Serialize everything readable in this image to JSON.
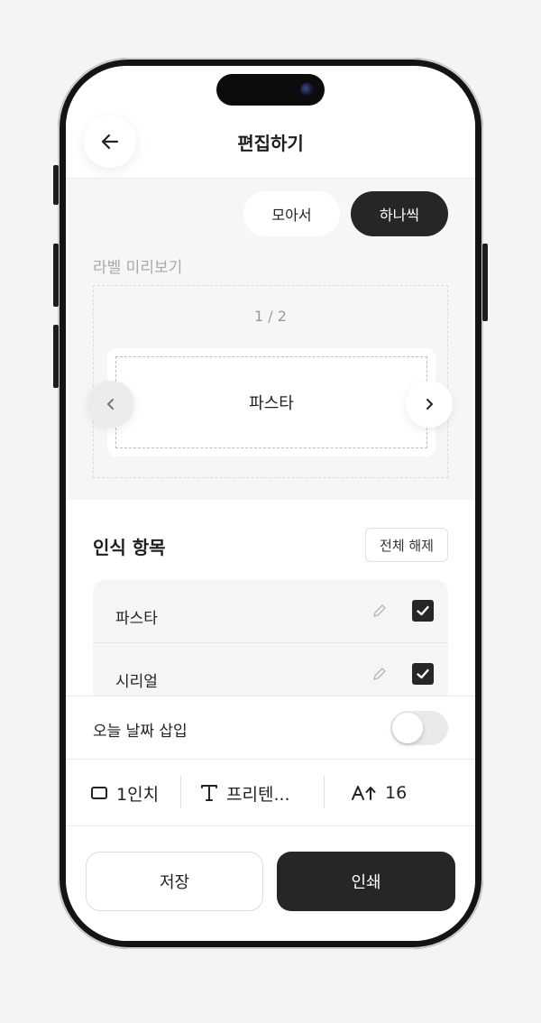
{
  "header": {
    "title": "편집하기",
    "back_icon": "arrow-left-icon"
  },
  "preview": {
    "mode_gather": "모아서",
    "mode_single": "하나씩",
    "active_mode": "하나씩",
    "section_label": "라벨 미리보기",
    "page_counter": "1 / 2",
    "label_text": "파스타"
  },
  "recognized": {
    "title": "인식 항목",
    "deselect_all": "전체 해제",
    "items": [
      {
        "label": "파스타",
        "checked": true
      },
      {
        "label": "시리얼",
        "checked": true
      }
    ]
  },
  "options": {
    "date_insert_label": "오늘 날짜 삽입",
    "date_insert_on": false,
    "label_size": "1인치",
    "font_name": "프리텐...",
    "font_size": "16"
  },
  "actions": {
    "save": "저장",
    "print": "인쇄"
  },
  "colors": {
    "accent_dark": "#262626",
    "background": "#f6f6f6"
  }
}
